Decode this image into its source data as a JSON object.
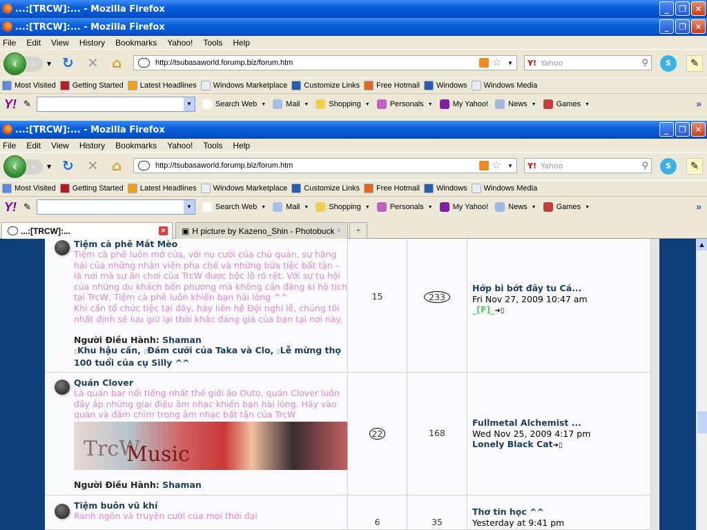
{
  "window": {
    "title": "...:[TRCW]:... - Mozilla Firefox",
    "controls": [
      "_",
      "❐",
      "✕"
    ]
  },
  "menu": [
    "File",
    "Edit",
    "View",
    "History",
    "Bookmarks",
    "Yahoo!",
    "Tools",
    "Help"
  ],
  "nav": {
    "url": "http://tsubasaworld.forump.biz/forum.htm",
    "search_placeholder": "Yahoo",
    "search_engine": "Y!"
  },
  "bookmarks": [
    {
      "label": "Most Visited",
      "color": "#5a8ad8"
    },
    {
      "label": "Getting Started",
      "color": "#b02020"
    },
    {
      "label": "Latest Headlines",
      "color": "#f0a020"
    },
    {
      "label": "Windows Marketplace",
      "color": "#e8eef6"
    },
    {
      "label": "Customize Links",
      "color": "#2a5cb0"
    },
    {
      "label": "Free Hotmail",
      "color": "#e06820"
    },
    {
      "label": "Windows",
      "color": "#2a5cb0"
    },
    {
      "label": "Windows Media",
      "color": "#e8eef6"
    }
  ],
  "yahoo_toolbar": {
    "logo": "Y!",
    "items": [
      {
        "label": "Search Web",
        "color": "#ffffff"
      },
      {
        "label": "Mail",
        "color": "#a8c0e8"
      },
      {
        "label": "Shopping",
        "color": "#f0d050"
      },
      {
        "label": "Personals",
        "color": "#c060c0"
      },
      {
        "label": "My Yahoo!",
        "color": "#8020a0"
      },
      {
        "label": "News",
        "color": "#a0b8e0"
      },
      {
        "label": "Games",
        "color": "#c04040"
      }
    ]
  },
  "tabs": [
    {
      "label": "...:[TRCW]:...",
      "active": true
    },
    {
      "label": "H picture by Kazeno_Shin - Photobucket",
      "active": false
    }
  ],
  "forums": [
    {
      "title": "Tiệm cà phê Mắt Mèo",
      "description": [
        "Tiệm cà phê luôn mở cửa, với nụ cười của chủ quán, sự hăng",
        "hái của những nhân viên pha chế và những bữa tiệc bất tận –",
        "là nơi mà sự ăn chơi của TrcW được bộc lộ rõ rệt. Với sự tụ hội",
        "của những du khách bốn phương mà không cần đăng kí hộ tịch",
        "tại TrcW, Tiệm cà phê luôn khiến bạn hài lòng ^^",
        "Khi cần tổ chức tiệc tại đây, hãy liên hệ Đội nghi lễ, chúng tôi",
        "nhất định sẽ lưu giữ lại thời khắc đáng giá của bạn tại nơi này."
      ],
      "moderator_label": "Người Điều Hành:",
      "moderator": "Shaman",
      "subforums": [
        "Khu hậu cần",
        "Đám cưới của Taka và Clo",
        "Lễ mừng thọ 100 tuổi của cụ Silly ^^"
      ],
      "topics": "15",
      "posts": "233",
      "posts_circled": true,
      "last_post": {
        "title": "Hớp bi bớt đây tu Cá...",
        "date": "Fri Nov 27, 2009 10:47 am",
        "user": "_[F]_",
        "user_color": "#5ac85a"
      }
    },
    {
      "title": "Quán Clover",
      "description": [
        "Là quán bar nổi tiếng nhất thế giới ảo Outo, quán Clover luôn",
        "đầy ắp những giai điệu âm nhạc khiến bạn hài lòng. Hãy vào",
        "quán và đắm chìm trong âm nhạc bất tận của TrcW"
      ],
      "banner": {
        "text1": "TrcW",
        "text2": "Music"
      },
      "moderator_label": "Người Điều Hành:",
      "moderator": "Shaman",
      "topics": "22",
      "topics_circled": true,
      "posts": "168",
      "last_post": {
        "title": "Fullmetal Alchemist ...",
        "date": "Wed Nov 25, 2009 4:17 pm",
        "user": "Lonely Black Cat",
        "user_color": "#1a3e5a"
      }
    },
    {
      "title": "Tiệm buôn vũ khí",
      "description": [
        "Ranh ngôn và truyện cười của mọi thời đại"
      ],
      "topics": "6",
      "posts": "35",
      "last_post": {
        "title": "Thơ tin học ^^",
        "date": "Yesterday at 9:41 pm"
      }
    }
  ],
  "colors": {
    "title_bar": "#0554d0",
    "page_bg": "#0f3f7a",
    "forum_link": "#1a3e5a",
    "description": "#dd86d0"
  }
}
